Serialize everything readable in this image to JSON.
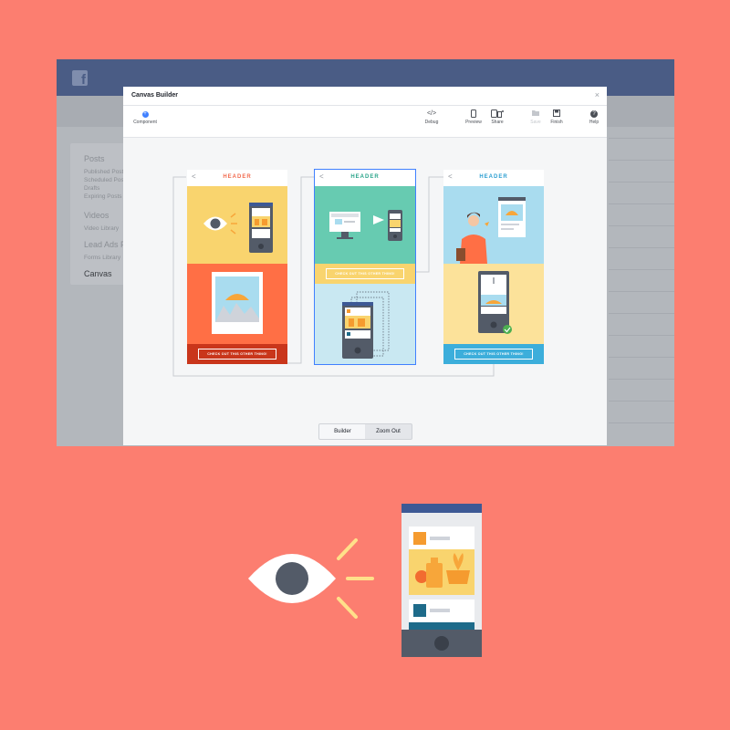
{
  "facebook": {
    "logo_glyph": "f",
    "sidebar": {
      "sections": [
        {
          "label": "Posts",
          "items": [
            "Published Posts",
            "Scheduled Posts",
            "Drafts",
            "Expiring Posts"
          ]
        },
        {
          "label": "Videos",
          "items": [
            "Video Library"
          ]
        },
        {
          "label": "Lead Ads Forms",
          "items": [
            "Forms Library"
          ]
        }
      ],
      "active_item": "Canvas"
    }
  },
  "modal": {
    "title": "Canvas Builder",
    "close_glyph": "×",
    "toolbar": {
      "component_label": "Component",
      "component_glyph": "+",
      "debug_label": "Debug",
      "debug_glyph": "</>",
      "preview_label": "Preview",
      "share_label": "Share",
      "save_label": "Save",
      "finish_label": "Finish",
      "help_label": "Help",
      "help_glyph": "?"
    },
    "footer": {
      "builder_label": "Builder",
      "zoom_out_label": "Zoom Out",
      "active_tab": "Zoom Out"
    }
  },
  "panels": [
    {
      "header": "HEADER",
      "header_color": "#F26B4F",
      "cta": "CHECK OUT THIS OTHER THING!"
    },
    {
      "header": "HEADER",
      "header_color": "#2BA58A",
      "cta": "CHECK OUT THIS OTHER THING!",
      "selected": true
    },
    {
      "header": "HEADER",
      "header_color": "#2D9FD1",
      "cta": "CHECK OUT THIS OTHER THING!"
    }
  ],
  "colors": {
    "background": "#FC7E70",
    "fb_blue": "#4A5C85",
    "accent": "#4080FF",
    "yellow": "#F9D46E",
    "teal": "#67CBB1",
    "sky": "#A9DCEF",
    "orange": "#FF6F45",
    "cta_red": "#C9361B",
    "cta_blue": "#3CAEDB"
  }
}
